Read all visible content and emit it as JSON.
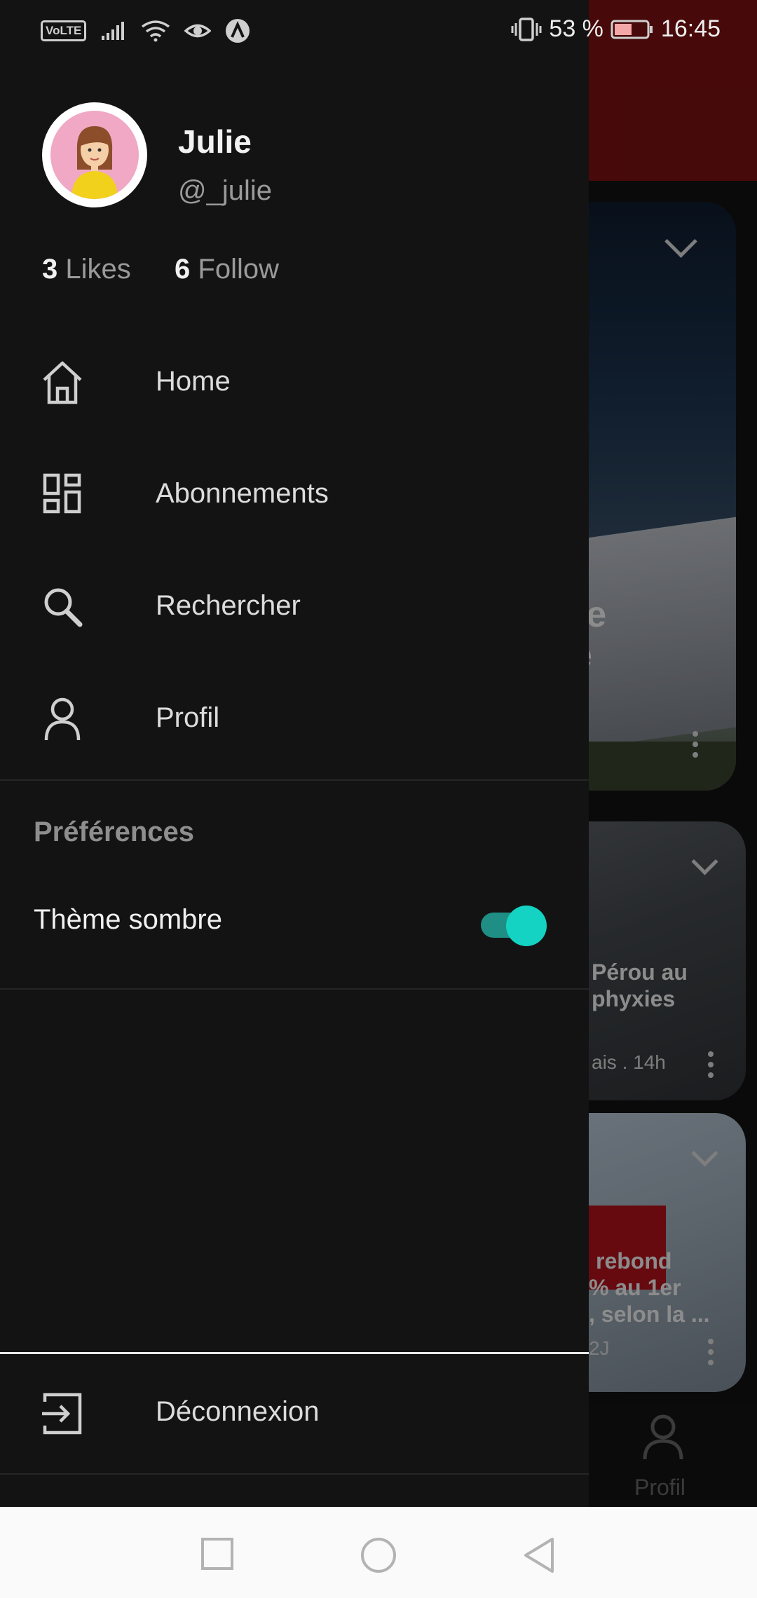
{
  "status_bar": {
    "network_badge": "VoLTE",
    "battery_percent": "53 %",
    "time": "16:45",
    "icons": [
      "signal-icon",
      "wifi-icon",
      "eye-icon",
      "app-notification-icon",
      "vibrate-icon",
      "battery-icon"
    ]
  },
  "drawer": {
    "user": {
      "name": "Julie",
      "handle": "@_julie"
    },
    "stats": {
      "likes_count": "3",
      "likes_label": "Likes",
      "follow_count": "6",
      "follow_label": "Follow"
    },
    "menu": [
      {
        "label": "Home",
        "icon": "home-icon"
      },
      {
        "label": "Abonnements",
        "icon": "dashboard-icon"
      },
      {
        "label": "Rechercher",
        "icon": "search-icon"
      },
      {
        "label": "Profil",
        "icon": "person-icon"
      }
    ],
    "preferences": {
      "title": "Préférences",
      "dark_theme_label": "Thème sombre",
      "dark_theme_enabled": true
    },
    "logout_label": "Déconnexion"
  },
  "background": {
    "card1_text": [
      "re",
      "e"
    ],
    "card2_text": [
      "Pérou au",
      "phyxies"
    ],
    "card2_meta": "ais . 14h",
    "card3_text": [
      "rebond",
      "% au 1er",
      ", selon la ..."
    ],
    "card3_meta": "2J",
    "bottom_nav_label": "Profil"
  },
  "colors": {
    "drawer_bg": "#131313",
    "accent_toggle": "#14d3c2",
    "header_red": "#7a1111"
  }
}
